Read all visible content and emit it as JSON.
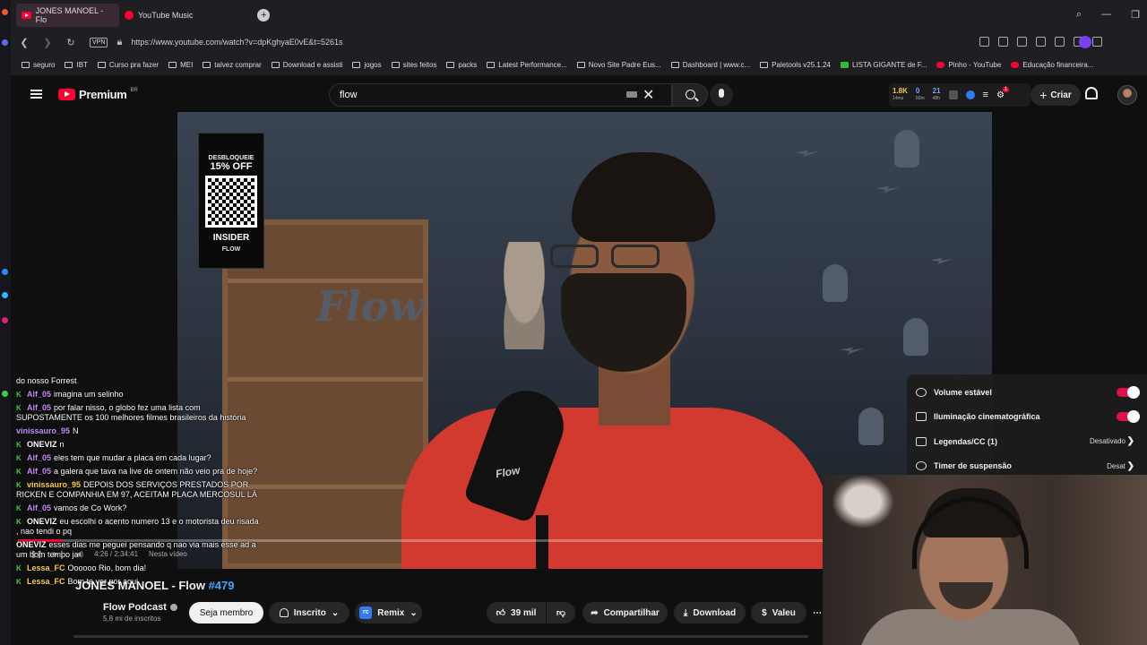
{
  "browser": {
    "tabs": [
      {
        "label": "JONES MANOEL - Flo",
        "active": true
      },
      {
        "label": "YouTube Music",
        "active": false
      }
    ],
    "new_tab_label": "+",
    "url": "https://www.youtube.com/watch?v=dpKghyaE0vE&t=5261s",
    "vpn_label": "VPN",
    "bookmarks": [
      "seguro",
      "IBT",
      "Curso pra fazer",
      "MEI",
      "talvez comprar",
      "Download e assisti",
      "jogos",
      "sites feitos",
      "packs",
      "Latest Performance...",
      "Novo Site Padre Eus...",
      "Dashboard | www.c...",
      "Paletools v25.1.24",
      "LISTA GIGANTE de F...",
      "Pinho - YouTube",
      "Educação financeira..."
    ]
  },
  "youtube": {
    "logo": "Premium",
    "logo_region": "BR",
    "search_value": "flow",
    "create_label": "Criar",
    "stats": [
      {
        "value": "1.8K",
        "sub": "14ms"
      },
      {
        "value": "0",
        "sub": "60m"
      },
      {
        "value": "21",
        "sub": "48h"
      }
    ],
    "notification_count": "1"
  },
  "video": {
    "overlay": {
      "line1": "DESBLOQUEIE",
      "line2": "15% OFF",
      "line3": "INSIDER",
      "line4": "FLOW"
    },
    "mic_label": "Flow",
    "wall_logo": "Flow",
    "progress_fraction": 0.055,
    "time_label": "4:26 / 2:34:41",
    "chapter_label": "Nesta vídeo"
  },
  "settings_menu": [
    {
      "label": "Volume estável",
      "value": "",
      "toggle": true
    },
    {
      "label": "Iluminação cinematográfica",
      "value": "",
      "toggle": true
    },
    {
      "label": "Legendas/CC (1)",
      "value": "Desativado",
      "toggle": false
    },
    {
      "label": "Timer de suspensão",
      "value": "Desat",
      "toggle": false
    }
  ],
  "chat": [
    {
      "user": "",
      "text": "do nosso Forrest",
      "color": "#ffffff",
      "badge": false
    },
    {
      "user": "Alf_05",
      "text": "imagina um selinho",
      "color": "#c88bff",
      "badge": true
    },
    {
      "user": "Alf_05",
      "text": "por falar nisso, o globo fez uma lista com SUPOSTAMENTE os 100 melhores filmes brasileiros da história",
      "color": "#c88bff",
      "badge": true
    },
    {
      "user": "vinissauro_95",
      "text": "N",
      "color": "#c88bff",
      "badge": false
    },
    {
      "user": "ONEVIZ",
      "text": "n",
      "color": "#ffffff",
      "badge": true
    },
    {
      "user": "Alf_05",
      "text": "eles tem que mudar a placa em cada lugar?",
      "color": "#c88bff",
      "badge": true
    },
    {
      "user": "Alf_05",
      "text": "a galera que tava na live de ontem não veio pra de hoje?",
      "color": "#c88bff",
      "badge": true
    },
    {
      "user": "vinissauro_95",
      "text": "DEPOIS DOS SERVIÇOS PRESTADOS POR RICKEN E COMPANHIA EM 97, ACEITAM PLACA MERCOSUL LÁ",
      "color": "#ffd23f",
      "badge": true
    },
    {
      "user": "Alf_05",
      "text": "vamos de Co Work?",
      "color": "#c88bff",
      "badge": true
    },
    {
      "user": "ONEVIZ",
      "text": "eu escolhi o acento numero 13 e o motorista deu risada , nao tendi o pq",
      "color": "#ffffff",
      "badge": true
    },
    {
      "user": "ONEVIZ",
      "text": "esses dias me peguei pensando q nao via mais esse ad a um bom tempo ja",
      "color": "#ffffff",
      "badge": false
    },
    {
      "user": "Lessa_FC",
      "text": "Oooooo Rio, bom dia!",
      "color": "#ffd23f",
      "badge": true
    },
    {
      "user": "Lessa_FC",
      "text": "Bom te ver por aqui",
      "color": "#ffd23f",
      "badge": true
    }
  ],
  "info": {
    "title_main": "JONES MANOEL - Flow ",
    "title_tag": "#479",
    "channel": "Flow Podcast",
    "subscribers": "5,8 mi de inscritos",
    "join_label": "Seja membro",
    "subscribed_label": "Inscrito",
    "remix_label": "Remix",
    "likes_label": "39 mil",
    "share_label": "Compartilhar",
    "download_label": "Download",
    "thanks_label": "Valeu"
  },
  "colors": {
    "accent": "#ff0033",
    "toggle_on": "#e0114a",
    "link_blue": "#3ea6ff"
  }
}
